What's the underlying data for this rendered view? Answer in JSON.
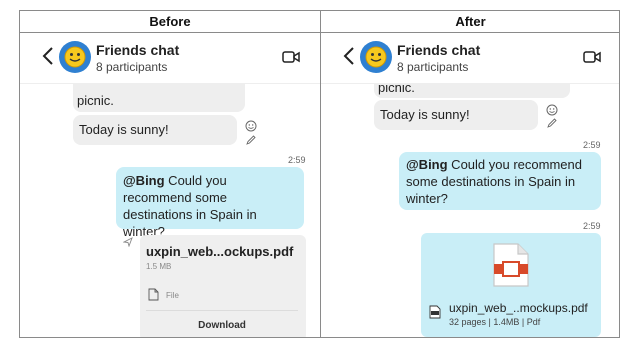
{
  "columns": {
    "before": "Before",
    "after": "After"
  },
  "chat": {
    "title": "Friends chat",
    "participants": "8 participants"
  },
  "before": {
    "partial_message": "picnic.",
    "message_sunny": "Today is sunny!",
    "time": "2:59",
    "bing_mention": "@Bing",
    "bing_text": " Could you recommend some destinations in Spain in winter?",
    "file": {
      "name": "uxpin_web...ockups.pdf",
      "size": "1.5 MB",
      "type": "File",
      "download": "Download"
    }
  },
  "after": {
    "partial_message": "picnic.",
    "message_sunny": "Today is sunny!",
    "time1": "2:59",
    "bing_mention": "@Bing",
    "bing_text": " Could you recommend some destinations in Spain in winter?",
    "time2": "2:59",
    "file": {
      "name": "uxpin_web_..mockups.pdf",
      "meta": "32 pages | 1.4MB | Pdf"
    }
  },
  "icons": {
    "back": "chevron-left-icon",
    "video": "video-call-icon",
    "avatar": "smiley-avatar-icon",
    "react": "emoji-react-icon",
    "edit": "pencil-icon",
    "send": "sent-arrow-icon",
    "file": "document-icon",
    "pdf": "pdf-file-icon"
  }
}
